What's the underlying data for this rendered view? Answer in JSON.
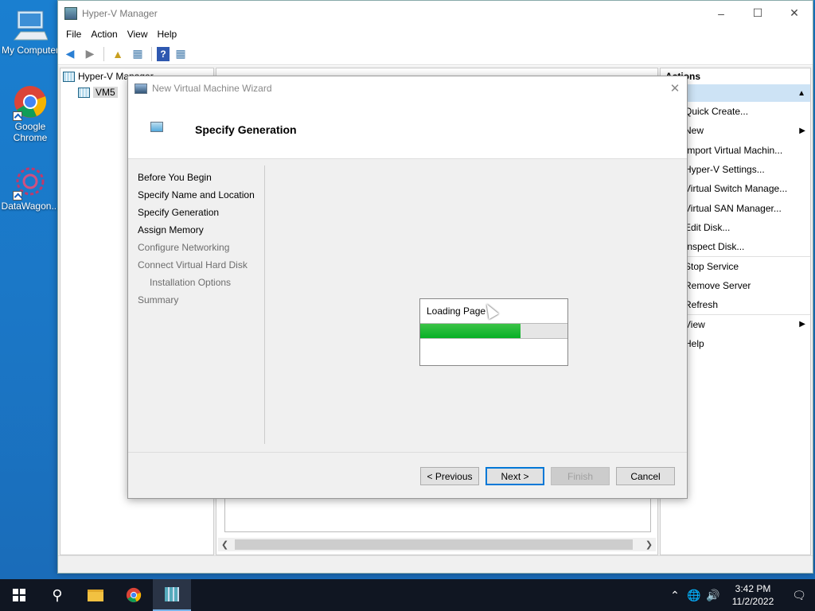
{
  "desktop": {
    "icons": [
      {
        "label": "My Computer",
        "icon": "computer-icon"
      },
      {
        "label": "Google Chrome",
        "icon": "chrome-icon"
      },
      {
        "label": "DataWagon...",
        "icon": "datawagon-icon"
      }
    ]
  },
  "window": {
    "title": "Hyper-V Manager",
    "menu": [
      "File",
      "Action",
      "View",
      "Help"
    ],
    "tree": {
      "root": "Hyper-V Manager",
      "child": "VM5"
    },
    "actions": {
      "header": "Actions",
      "items": [
        {
          "label": "Quick Create...",
          "submenu": false
        },
        {
          "label": "New",
          "submenu": true
        },
        {
          "label": "Import Virtual Machin...",
          "submenu": false
        },
        {
          "label": "Hyper-V Settings...",
          "submenu": false
        },
        {
          "label": "Virtual Switch Manage...",
          "submenu": false
        },
        {
          "label": "Virtual SAN Manager...",
          "submenu": false
        },
        {
          "label": "Edit Disk...",
          "submenu": false
        },
        {
          "label": "Inspect Disk...",
          "submenu": false
        },
        {
          "label": "Stop Service",
          "submenu": false
        },
        {
          "label": "Remove Server",
          "submenu": false
        },
        {
          "label": "Refresh",
          "submenu": false
        },
        {
          "label": "View",
          "submenu": true
        },
        {
          "label": "Help",
          "submenu": false
        }
      ]
    }
  },
  "wizard": {
    "title": "New Virtual Machine Wizard",
    "heading": "Specify Generation",
    "steps": [
      {
        "label": "Before You Begin",
        "dim": false,
        "indent": false
      },
      {
        "label": "Specify Name and Location",
        "dim": false,
        "indent": false
      },
      {
        "label": "Specify Generation",
        "dim": false,
        "indent": false
      },
      {
        "label": "Assign Memory",
        "dim": false,
        "indent": false
      },
      {
        "label": "Configure Networking",
        "dim": true,
        "indent": false
      },
      {
        "label": "Connect Virtual Hard Disk",
        "dim": true,
        "indent": false
      },
      {
        "label": "Installation Options",
        "dim": true,
        "indent": true
      },
      {
        "label": "Summary",
        "dim": true,
        "indent": false
      }
    ],
    "loading": {
      "text": "Loading Page",
      "progress": 0.68
    },
    "buttons": {
      "previous": "< Previous",
      "next": "Next >",
      "finish": "Finish",
      "cancel": "Cancel"
    }
  },
  "taskbar": {
    "time": "3:42 PM",
    "date": "11/2/2022"
  },
  "colors": {
    "progress": "#06b025",
    "accent": "#0078d7",
    "desktop": "#1a7fd0"
  }
}
